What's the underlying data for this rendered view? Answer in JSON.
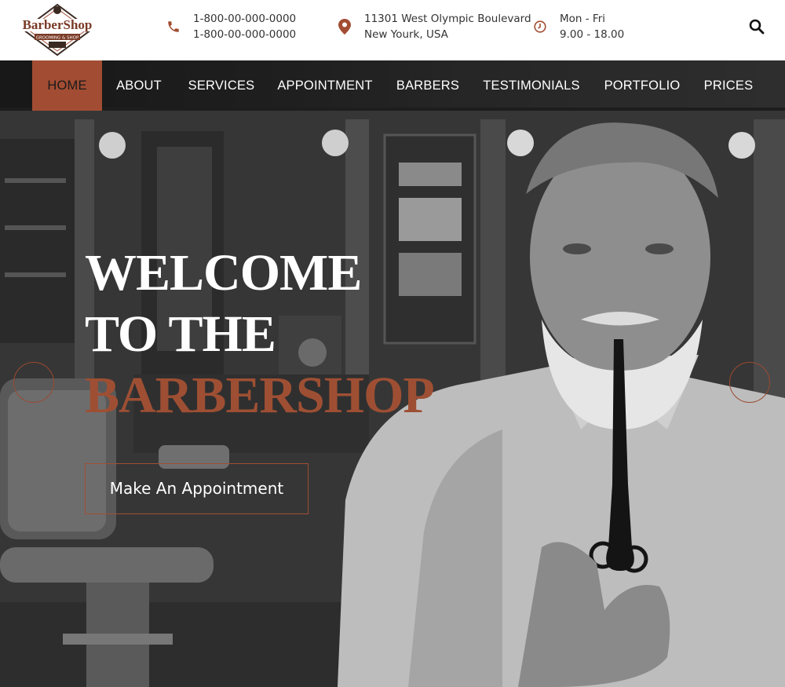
{
  "brand": {
    "name": "BarberShop",
    "tagline": "GROOMING & SHOP",
    "color": "#a24d33"
  },
  "contacts": {
    "phone": {
      "icon": "phone-icon",
      "line1": "1-800-00-000-0000",
      "line2": "1-800-00-000-0000"
    },
    "address": {
      "icon": "location-pin-icon",
      "line1": "11301 West Olympic Boulevard",
      "line2": "New Yourk, USA"
    },
    "hours": {
      "icon": "clock-icon",
      "line1": "Mon - Fri",
      "line2": "9.00 - 18.00"
    }
  },
  "search": {
    "icon": "search-icon"
  },
  "nav": {
    "items": [
      {
        "label": "HOME",
        "active": true
      },
      {
        "label": "ABOUT"
      },
      {
        "label": "SERVICES"
      },
      {
        "label": "APPOINTMENT"
      },
      {
        "label": "BARBERS"
      },
      {
        "label": "TESTIMONIALS"
      },
      {
        "label": "PORTFOLIO"
      },
      {
        "label": "PRICES"
      }
    ]
  },
  "hero": {
    "line1": "WELCOME",
    "line2": "TO THE",
    "line3": "BARBERSHOP",
    "cta": "Make An Appointment",
    "accent": "#9e4f33"
  },
  "slider": {
    "prev_icon": "slider-prev-icon",
    "next_icon": "slider-next-icon"
  }
}
